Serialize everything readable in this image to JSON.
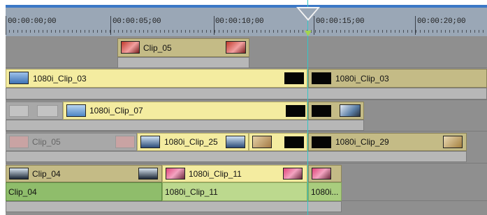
{
  "ruler": {
    "timecodes": [
      "00:00:00;00",
      "00:00:05;00",
      "00:00:10;00",
      "00:00:15;00",
      "00:00:20;00"
    ]
  },
  "tracks": {
    "t1": {
      "clip_a": "Clip_05"
    },
    "t2": {
      "clip_a": "1080i_Clip_03",
      "clip_b": "1080i_Clip_03"
    },
    "t3": {
      "clip_a": "1080i_Clip_07"
    },
    "t4": {
      "clip_ghost": "Clip_05",
      "clip_a": "1080i_Clip_25",
      "clip_b": "1080i_Clip_29"
    },
    "t5": {
      "clip_a": "Clip_04",
      "clip_b": "1080i_Clip_11"
    },
    "t5_audio": {
      "clip_a": "Clip_04",
      "clip_b": "1080i_Clip_11",
      "clip_c": "1080i..."
    }
  },
  "colors": {
    "clip_yellow": "#f4eca0",
    "clip_olive": "#c4bb86",
    "audio_green": "#8fbd6b",
    "audio_light": "#bcd98e",
    "playhead": "#33c7c7",
    "marker_blue": "#2f79cc"
  }
}
